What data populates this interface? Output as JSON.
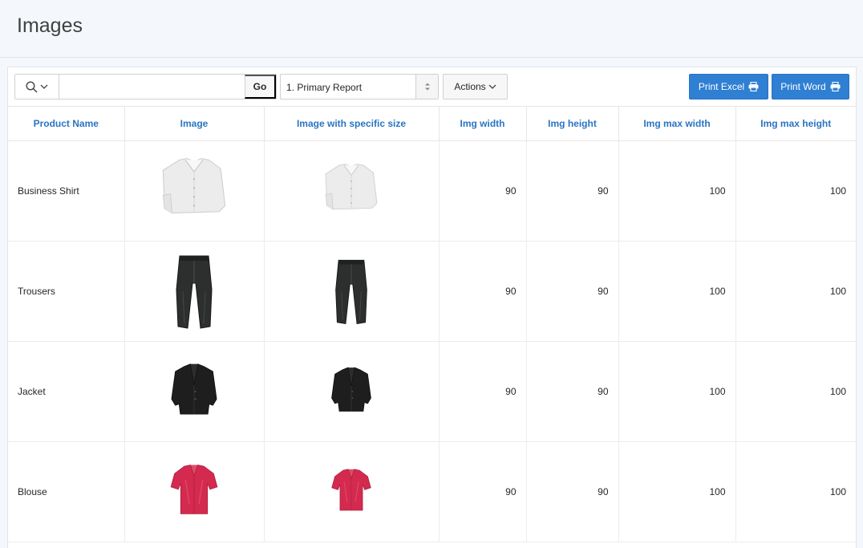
{
  "page": {
    "title": "Images"
  },
  "toolbar": {
    "search_placeholder": "",
    "search_value": "",
    "go_label": "Go",
    "report_select_value": "1. Primary Report",
    "actions_label": "Actions",
    "print_excel_label": "Print Excel",
    "print_word_label": "Print Word"
  },
  "table": {
    "columns": [
      "Product Name",
      "Image",
      "Image with specific size",
      "Img width",
      "Img height",
      "Img max width",
      "Img max height"
    ],
    "rows": [
      {
        "product_name": "Business Shirt",
        "image_icon": "white-shirt-image",
        "img_width": "90",
        "img_height": "90",
        "img_max_width": "100",
        "img_max_height": "100"
      },
      {
        "product_name": "Trousers",
        "image_icon": "black-trousers-image",
        "img_width": "90",
        "img_height": "90",
        "img_max_width": "100",
        "img_max_height": "100"
      },
      {
        "product_name": "Jacket",
        "image_icon": "black-jacket-image",
        "img_width": "90",
        "img_height": "90",
        "img_max_width": "100",
        "img_max_height": "100"
      },
      {
        "product_name": "Blouse",
        "image_icon": "red-blouse-image",
        "img_width": "90",
        "img_height": "90",
        "img_max_width": "100",
        "img_max_height": "100"
      }
    ]
  },
  "colors": {
    "accent": "#2f7fd3",
    "header_text": "#2a74c2",
    "header_bg": "#f4f8fd"
  }
}
